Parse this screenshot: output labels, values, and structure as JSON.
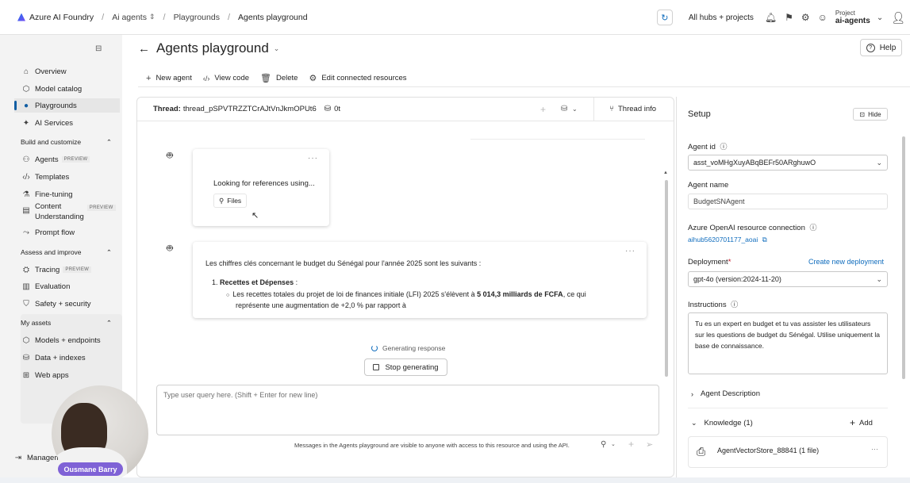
{
  "topbar": {
    "brand": "Azure AI Foundry",
    "breadcrumbs": [
      "Ai agents",
      "Playgrounds",
      "Agents playground"
    ],
    "hubs_label": "All hubs + projects",
    "project_caption": "Project",
    "project_name": "ai-agents"
  },
  "sidebar": {
    "top_items": [
      {
        "label": "Overview",
        "icon": "home-icon"
      },
      {
        "label": "Model catalog",
        "icon": "cube-icon"
      },
      {
        "label": "Playgrounds",
        "icon": "chat-icon",
        "active": true
      },
      {
        "label": "AI Services",
        "icon": "sparkle-icon"
      }
    ],
    "build_section": "Build and customize",
    "build_items": [
      {
        "label": "Agents",
        "badge": "PREVIEW"
      },
      {
        "label": "Templates"
      },
      {
        "label": "Fine-tuning"
      },
      {
        "label": "Content",
        "label2": "Understanding",
        "badge": "PREVIEW"
      },
      {
        "label": "Prompt flow"
      }
    ],
    "assess_section": "Assess and improve",
    "assess_items": [
      {
        "label": "Tracing",
        "badge": "PREVIEW"
      },
      {
        "label": "Evaluation"
      },
      {
        "label": "Safety + security"
      }
    ],
    "assets_section": "My assets",
    "assets_items": [
      {
        "label": "Models + endpoints"
      },
      {
        "label": "Data + indexes"
      },
      {
        "label": "Web apps"
      }
    ],
    "manage_label": "Management"
  },
  "main": {
    "title": "Agents playground",
    "help_label": "Help",
    "toolbar": {
      "new_agent": "New agent",
      "view_code": "View code",
      "delete": "Delete",
      "edit_resources": "Edit connected resources"
    }
  },
  "chat": {
    "thread_label": "Thread:",
    "thread_id": "thread_pSPVTRZZTCrAJtVnJkmOPUt6",
    "token_count": "0t",
    "thread_info": "Thread info",
    "msg1": {
      "text": "Looking for references using...",
      "chip": "Files"
    },
    "msg2": {
      "intro": "Les chiffres clés concernant le budget du Sénégal pour l'année 2025 sont les suivants :",
      "item_number": "1.",
      "item_title": "Recettes et Dépenses",
      "item_colon": " :",
      "bullet_pre": "Les recettes totales du projet de loi de finances initiale (LFI) 2025 s'élèvent à ",
      "bullet_bold": "5 014,3 milliards de FCFA",
      "bullet_post": ", ce qui",
      "bullet_line2": "représente une augmentation de +2,0 % par rapport à"
    },
    "generating": "Generating response",
    "stop_label": "Stop generating",
    "input_placeholder": "Type user query here. (Shift + Enter for new line)",
    "footer_note": "Messages in the Agents playground are visible to anyone with access to this resource and using the API."
  },
  "setup": {
    "title": "Setup",
    "hide_label": "Hide",
    "agent_id_label": "Agent id",
    "agent_id_value": "asst_voMHgXuyABqBEFr50ARghuwO",
    "agent_name_label": "Agent name",
    "agent_name_value": "BudgetSNAgent",
    "connection_label": "Azure OpenAI resource connection",
    "connection_value": "aihub5620701177_aoai",
    "deployment_label": "Deployment",
    "deployment_required": "*",
    "create_deployment": "Create new deployment",
    "deployment_value": "gpt-4o (version:2024-11-20)",
    "instructions_label": "Instructions",
    "instructions_value": "Tu es un expert en budget et tu vas assister les utilisateurs sur les questions de budget du Sénégal. Utilise uniquement la base de connaissance.",
    "agent_description": "Agent Description",
    "knowledge_label": "Knowledge (1)",
    "add_label": "Add",
    "vector_store": "AgentVectorStore_88841 (1 file)"
  },
  "presenter": {
    "name": "Ousmane Barry"
  }
}
